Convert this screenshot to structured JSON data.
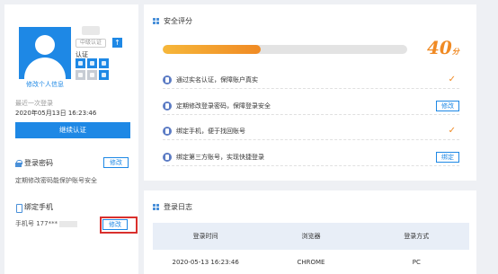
{
  "profile": {
    "edit_info_label": "修改个人信息",
    "unverified_tag": "中级认证",
    "up_icon": "↑",
    "certification_label": "认证",
    "last_login_label": "最近一次登录",
    "last_login_time": "2020年05月13日 16:23:46",
    "continue_button": "继续认证"
  },
  "password_section": {
    "title": "登录密码",
    "description": "定期修改密码能保护账号安全",
    "edit_button": "修改"
  },
  "phone_section": {
    "title": "绑定手机",
    "number_prefix": "手机号 177***",
    "edit_button": "修改"
  },
  "security": {
    "title": "安全评分",
    "progress_fraction": 0.4,
    "score": "40",
    "score_unit": "分",
    "items": [
      {
        "text": "通过实名认证，保障账户真实",
        "status": "check",
        "button": ""
      },
      {
        "text": "定期修改登录密码，保障登录安全",
        "status": "button",
        "button": "修改"
      },
      {
        "text": "绑定手机，便于找回账号",
        "status": "check",
        "button": ""
      },
      {
        "text": "绑定第三方账号，实现快捷登录",
        "status": "button",
        "button": "绑定"
      }
    ]
  },
  "login_log": {
    "title": "登录日志",
    "columns": [
      "登录时间",
      "浏览器",
      "登录方式"
    ],
    "rows": [
      [
        "2020-05-13 16:23:46",
        "CHROME",
        "PC"
      ]
    ]
  },
  "colors": {
    "accent": "#1e88e5",
    "score": "#f08a24",
    "highlight": "#d9302d"
  }
}
